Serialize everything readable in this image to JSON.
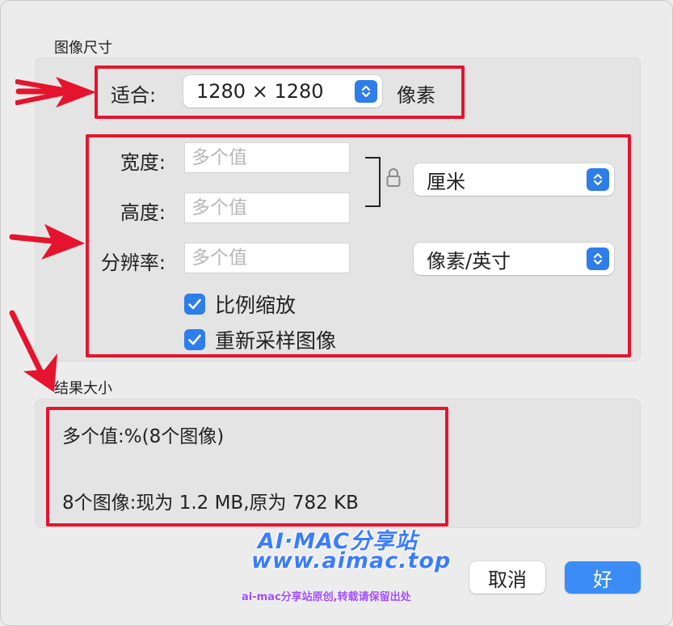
{
  "image_size": {
    "title": "图像尺寸",
    "fit_label": "适合:",
    "fit_value": "1280 × 1280",
    "fit_unit": "像素",
    "width_label": "宽度:",
    "width_placeholder": "多个值",
    "height_label": "高度:",
    "height_placeholder": "多个值",
    "resolution_label": "分辨率:",
    "resolution_placeholder": "多个值",
    "size_unit": "厘米",
    "resolution_unit": "像素/英寸",
    "scale_proportionally": "比例缩放",
    "resample_image": "重新采样图像"
  },
  "result_size": {
    "title": "结果大小",
    "line1": "多个值:%(8个图像)",
    "line2": "8个图像:现为 1.2 MB,原为 782 KB"
  },
  "buttons": {
    "cancel": "取消",
    "ok": "好"
  },
  "watermark": {
    "line1": "AI·MAC分享站",
    "line2": "www.aimac.top",
    "line3": "ai-mac分享站原创,转载请保留出处"
  },
  "colors": {
    "accent": "#2f7de8",
    "annotation_red": "#e5142e"
  }
}
